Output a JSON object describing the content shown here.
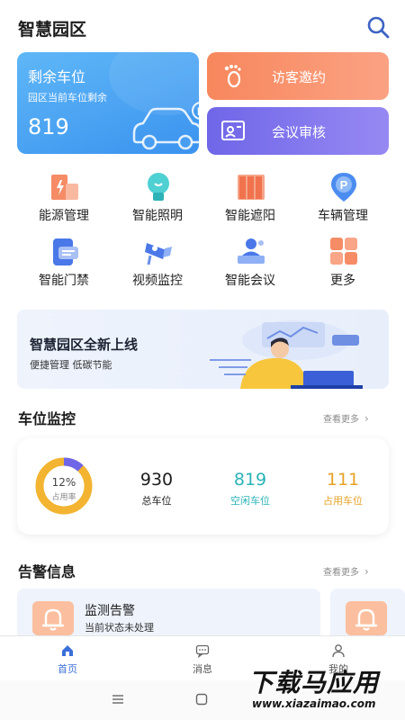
{
  "header": {
    "title": "智慧园区",
    "search_icon": "search-icon"
  },
  "parking_card": {
    "title": "剩余车位",
    "subtitle": "园区当前车位剩余",
    "value": "819",
    "icon": "car-icon",
    "color_start": "#5fb7f7",
    "color_end": "#3b93ef"
  },
  "quick_actions": [
    {
      "label": "访客邀约",
      "icon": "footprint-icon",
      "color": "#f7875d"
    },
    {
      "label": "会议审核",
      "icon": "meeting-review-icon",
      "color": "#6f66e8"
    }
  ],
  "grid": [
    {
      "label": "能源管理",
      "icon": "energy-icon"
    },
    {
      "label": "智能照明",
      "icon": "lightbulb-icon"
    },
    {
      "label": "智能遮阳",
      "icon": "sunshade-icon"
    },
    {
      "label": "车辆管理",
      "icon": "parking-icon"
    },
    {
      "label": "智能门禁",
      "icon": "access-card-icon"
    },
    {
      "label": "视频监控",
      "icon": "camera-icon"
    },
    {
      "label": "智能会议",
      "icon": "conference-icon"
    },
    {
      "label": "更多",
      "icon": "more-grid-icon"
    }
  ],
  "banner": {
    "title": "智慧园区全新上线",
    "subtitle": "便捷管理 低碳节能"
  },
  "parking_monitor": {
    "title": "车位监控",
    "more": "查看更多",
    "occupancy": 0.12,
    "occupancy_text": "12%",
    "occupancy_label": "占用率",
    "stats": [
      {
        "value": "930",
        "label": "总车位",
        "color": "#1c1c1c"
      },
      {
        "value": "819",
        "label": "空闲车位",
        "color": "#2bb3b6"
      },
      {
        "value": "111",
        "label": "占用车位",
        "color": "#e6a227"
      }
    ]
  },
  "alerts": {
    "title": "告警信息",
    "more": "查看更多",
    "items": [
      {
        "title": "监测告警",
        "subtitle": "当前状态未处理",
        "icon": "bell-icon"
      }
    ]
  },
  "tabbar": [
    {
      "label": "首页",
      "icon": "home-icon",
      "active": true
    },
    {
      "label": "消息",
      "icon": "message-icon",
      "active": false
    },
    {
      "label": "我的",
      "icon": "user-icon",
      "active": false
    }
  ],
  "watermark": {
    "text": "下载马应用",
    "url": "www.xiazaimao.com"
  },
  "colors": {
    "accent": "#3b6fd9",
    "orange": "#f7875d",
    "purple": "#6f66e8",
    "teal": "#2bb3b6",
    "gold": "#e6a227"
  }
}
